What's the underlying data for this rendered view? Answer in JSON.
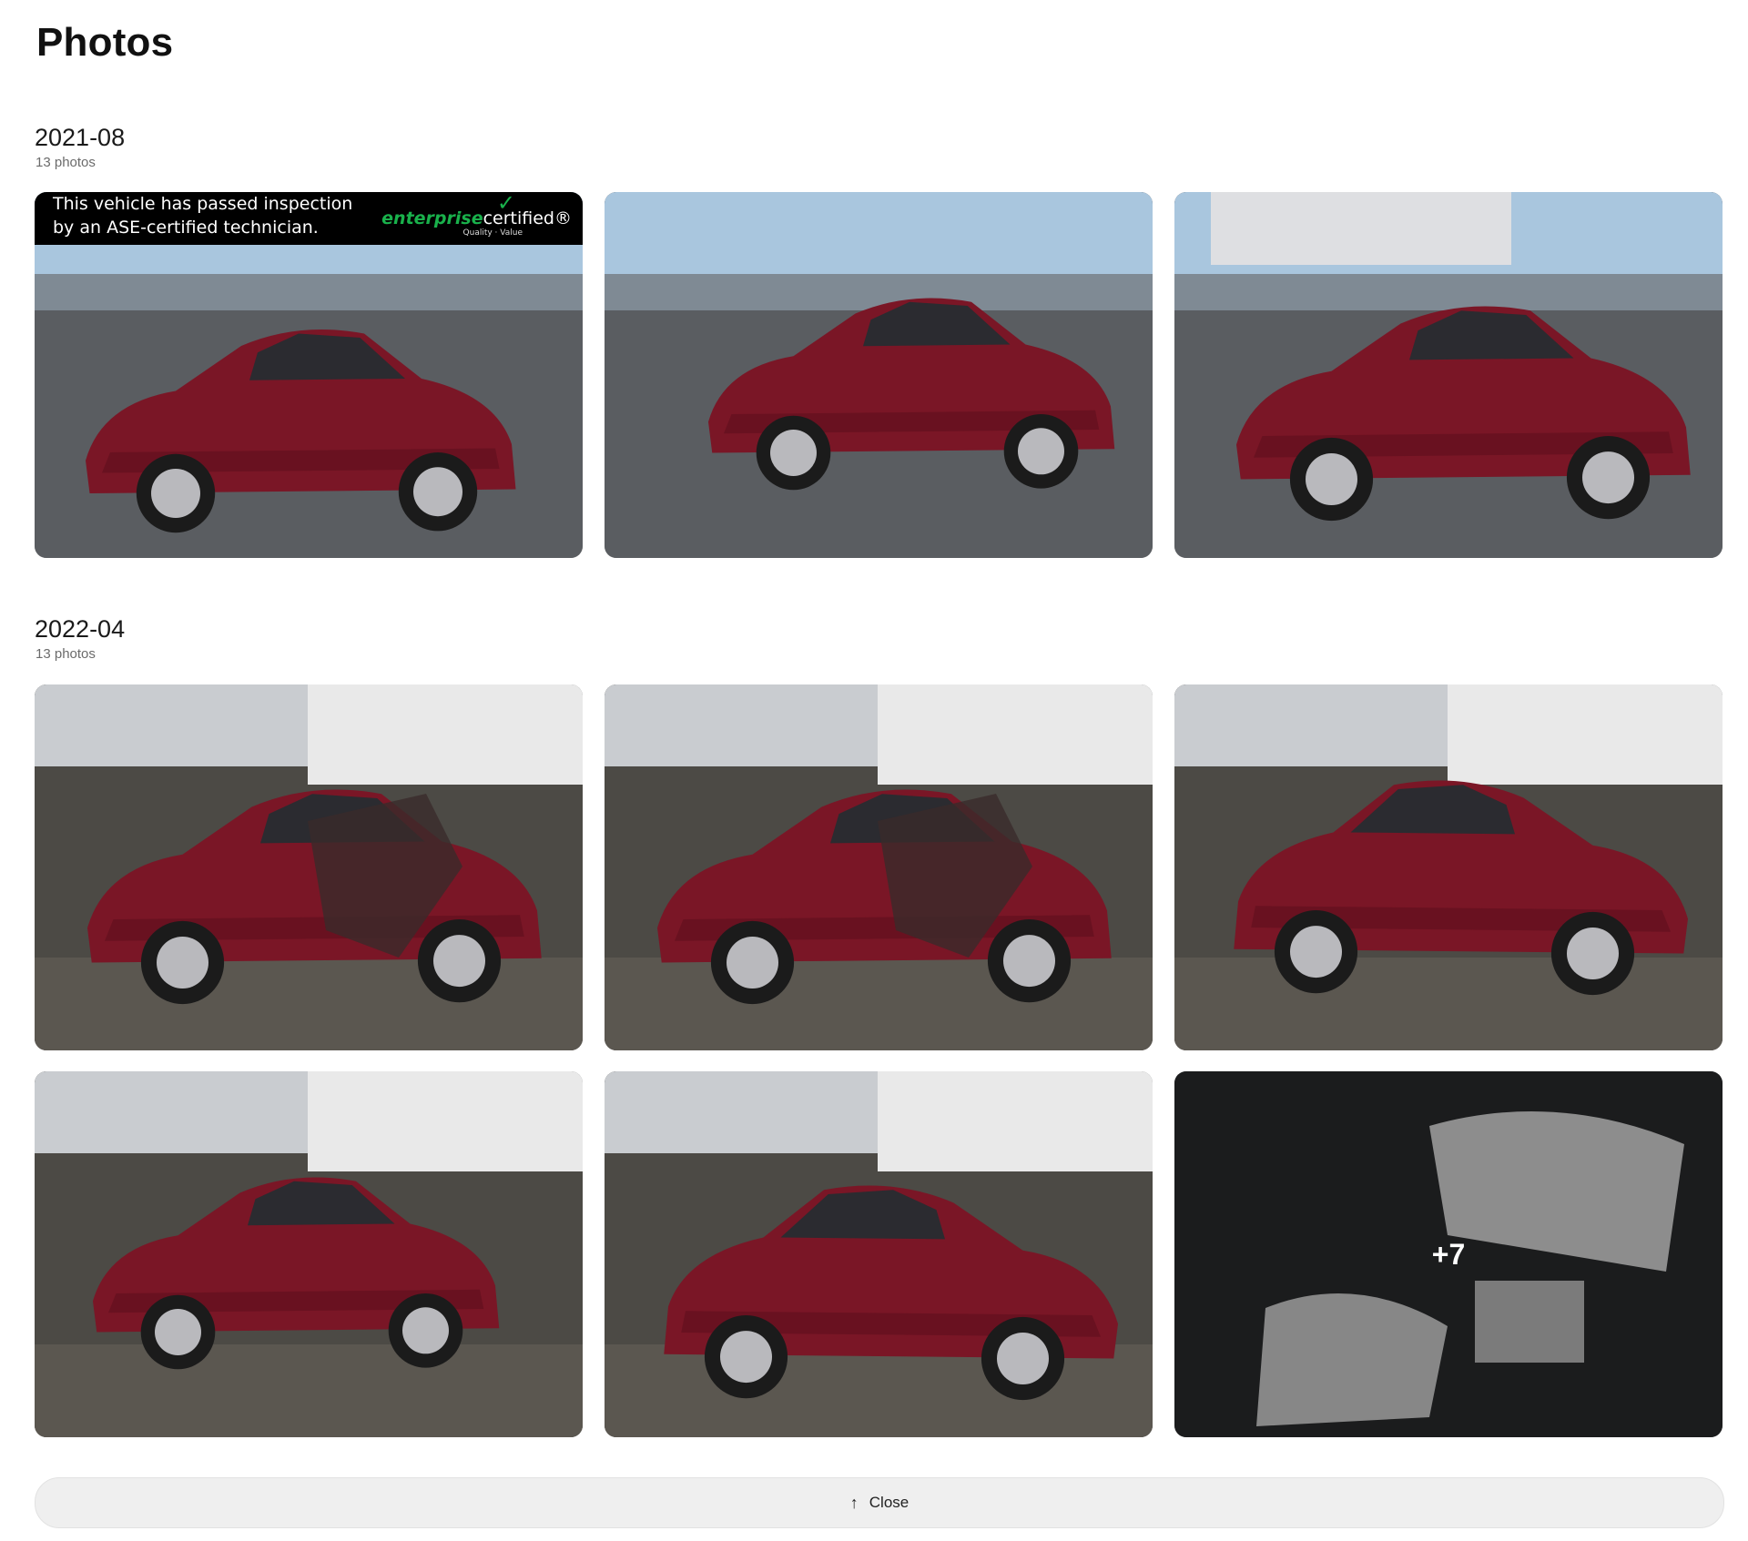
{
  "page": {
    "title": "Photos"
  },
  "sections": [
    {
      "date": "2021-08",
      "count": "13 photos",
      "photos": [
        {
          "alt": "Front three-quarter view of red sedan in dealership lot"
        },
        {
          "alt": "Rear three-quarter view of red sedan"
        },
        {
          "alt": "Front three-quarter view of red sedan near building"
        }
      ],
      "banner": {
        "text": "This vehicle has passed inspection\nby an ASE-certified technician.",
        "brand_a": "enterprise",
        "brand_b": "certified",
        "brand_mark": "®",
        "sub": "Quality · Value"
      }
    },
    {
      "date": "2022-04",
      "count": "13 photos",
      "photos": [
        {
          "alt": "Damaged front of red sedan in salvage yard"
        },
        {
          "alt": "Damaged front of red sedan, close view"
        },
        {
          "alt": "Front view of damaged red sedan"
        },
        {
          "alt": "Rear three-quarter view of red sedan in salvage yard"
        },
        {
          "alt": "Rear view of red sedan in salvage yard"
        },
        {
          "alt": "Interior with deployed airbags"
        }
      ],
      "more": "+7"
    }
  ],
  "close": {
    "label": "Close",
    "icon": "arrow-up-icon"
  },
  "colors": {
    "body_paint": "#7a1626",
    "background": "#ffffff",
    "close_bar": "#efefef"
  }
}
